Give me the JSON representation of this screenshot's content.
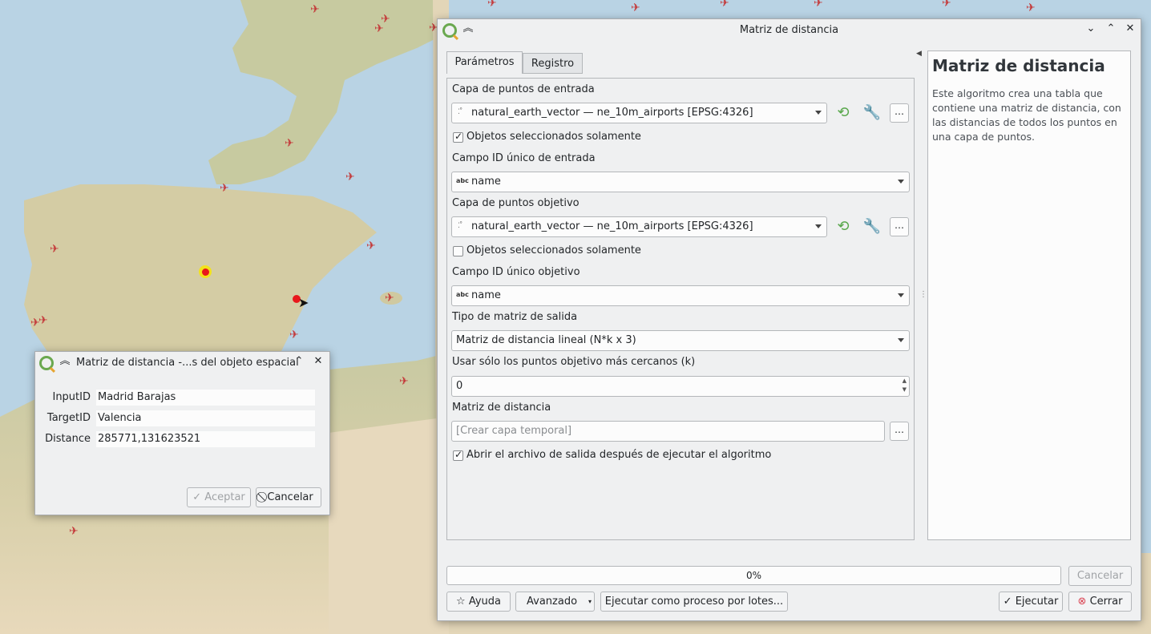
{
  "main_dialog": {
    "title": "Matriz de distancia",
    "tabs": [
      "Parámetros",
      "Registro"
    ],
    "input_layer_label": "Capa de puntos de entrada",
    "input_layer_value": "natural_earth_vector — ne_10m_airports [EPSG:4326]",
    "input_selected_only": "Objetos seleccionados solamente",
    "input_id_label": "Campo ID único de entrada",
    "input_id_value": "name",
    "target_layer_label": "Capa de puntos objetivo",
    "target_layer_value": "natural_earth_vector — ne_10m_airports [EPSG:4326]",
    "target_selected_only": "Objetos seleccionados solamente",
    "target_id_label": "Campo ID único objetivo",
    "target_id_value": "name",
    "matrix_type_label": "Tipo de matriz de salida",
    "matrix_type_value": "Matriz de distancia lineal (N*k x 3)",
    "nearest_label": "Usar sólo los puntos objetivo más cercanos (k)",
    "nearest_value": "0",
    "output_label": "Matriz de distancia",
    "output_placeholder": "[Crear capa temporal]",
    "open_output": "Abrir el archivo de salida después de ejecutar el algoritmo",
    "dots": "…",
    "help_title": "Matriz de distancia",
    "help_text": "Este algoritmo crea una tabla que contiene una matriz de distancia, con las distancias de todos los puntos en una capa de puntos.",
    "progress": "0%",
    "progress_value": 0,
    "cancel_label": "Cancelar",
    "help_button": "Ayuda",
    "advanced_button": "Avanzado",
    "batch_button": "Ejecutar como proceso por lotes...",
    "run_button": "Ejecutar",
    "close_button": "Cerrar"
  },
  "feature_dialog": {
    "title": "Matriz de distancia -...s del objeto espacial",
    "rows": [
      {
        "label": "InputID",
        "value": "Madrid Barajas"
      },
      {
        "label": "TargetID",
        "value": "Valencia"
      },
      {
        "label": "Distance",
        "value": "285771,131623521"
      }
    ],
    "accept_button": "Aceptar",
    "cancel_button": "Cancelar"
  },
  "colors": {
    "sea": "#b9d3e4",
    "land": "#d9d2b0",
    "qgis_green": "#6aa84f",
    "selected_point": "#e8181c",
    "airport_icon": "#c43a3a"
  },
  "icons": [
    "airport-icon",
    "qgis-logo-icon",
    "refresh-icon",
    "wrench-icon",
    "chevron-up-icon",
    "chevron-down-icon",
    "close-icon",
    "help-star-icon",
    "checkmark-icon",
    "stop-icon",
    "cursor-icon"
  ]
}
